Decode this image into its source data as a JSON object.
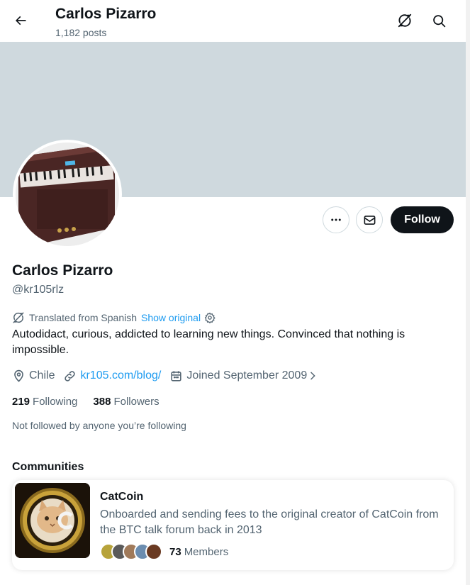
{
  "header": {
    "name": "Carlos Pizarro",
    "posts": "1,182 posts"
  },
  "profile": {
    "name": "Carlos Pizarro",
    "handle": "@kr105rlz",
    "follow_label": "Follow",
    "translated_label": "Translated from Spanish",
    "show_original": "Show original",
    "bio": "Autodidact, curious, addicted to learning new things. Convinced that nothing is impossible.",
    "location": "Chile",
    "website": "kr105.com/blog/",
    "joined": "Joined September 2009",
    "following_count": "219",
    "following_label": "Following",
    "followers_count": "388",
    "followers_label": "Followers",
    "not_followed": "Not followed by anyone you’re following"
  },
  "communities": {
    "title": "Communities",
    "items": [
      {
        "name": "CatCoin",
        "description": "Onboarded and sending fees to the original creator of CatCoin from the BTC talk forum back in 2013",
        "members_count": "73",
        "members_label": "Members"
      }
    ]
  },
  "colors": {
    "accent": "#1d9bf0",
    "banner": "#cfd9de",
    "text_secondary": "#536471",
    "follow_button": "#0f1419"
  },
  "icons": [
    "back-arrow-icon",
    "translate-icon",
    "search-icon",
    "more-icon",
    "mail-icon",
    "location-icon",
    "link-icon",
    "calendar-icon",
    "chevron-right-icon",
    "gear-icon"
  ]
}
